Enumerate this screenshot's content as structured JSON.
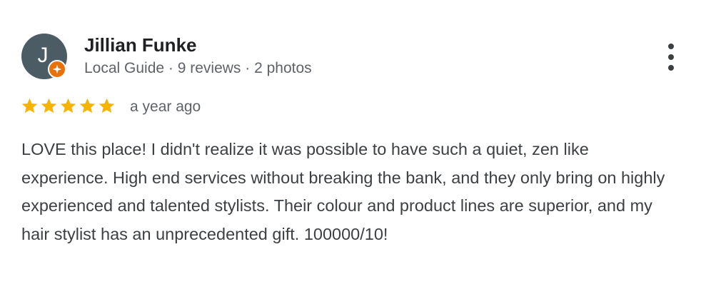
{
  "review": {
    "reviewer": {
      "initial": "J",
      "name": "Jillian Funke",
      "meta": "Local Guide · 9 reviews · 2 photos",
      "avatar_color": "#4b5c64",
      "badge_color": "#e8710a",
      "badge_icon": "local-guide-star-icon"
    },
    "rating": {
      "stars": 5,
      "max": 5,
      "star_color": "#f4b400"
    },
    "time": "a year ago",
    "text": "LOVE this place! I didn't realize it was possible to have such a quiet, zen like experience. High end services without breaking the bank, and they only bring on highly experienced and talented stylists. Their colour and product lines are superior, and my hair stylist has an unprecedented gift. 100000/10!",
    "more_options_icon": "more-vert-icon"
  }
}
